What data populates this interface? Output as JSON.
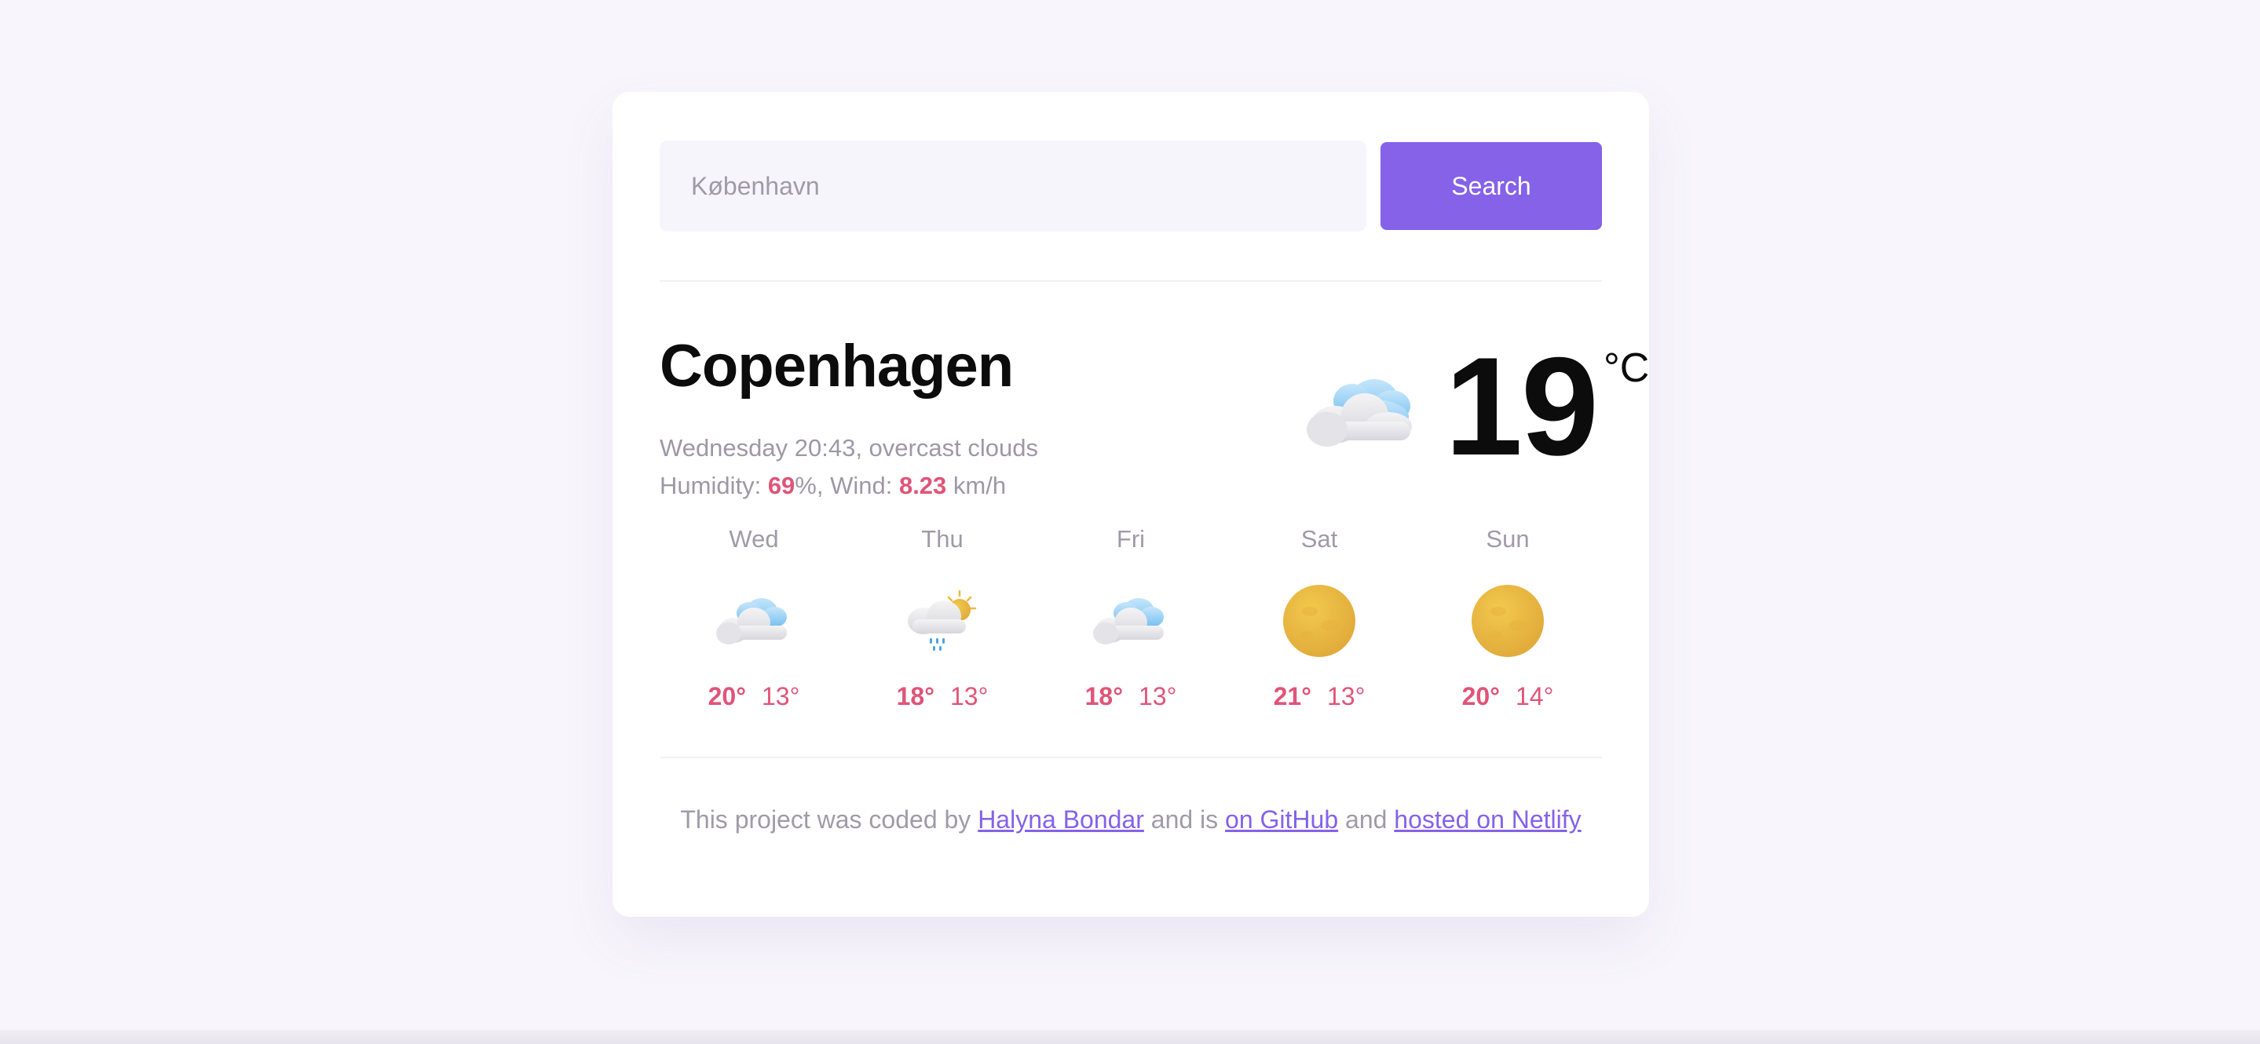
{
  "search": {
    "placeholder": "København",
    "button_label": "Search"
  },
  "current": {
    "city": "Copenhagen",
    "date_line": "Wednesday 20:43, overcast clouds",
    "humidity_label": "Humidity: ",
    "humidity_value": "69",
    "humidity_unit": "%, Wind: ",
    "wind_value": "8.23",
    "wind_unit": " km/h",
    "temperature": "19",
    "unit": "°C",
    "icon": "overcast-clouds-icon"
  },
  "forecast": [
    {
      "day": "Wed",
      "max": "20°",
      "min": "13°",
      "icon": "overcast-clouds-icon"
    },
    {
      "day": "Thu",
      "max": "18°",
      "min": "13°",
      "icon": "rain-sun-cloud-icon"
    },
    {
      "day": "Fri",
      "max": "18°",
      "min": "13°",
      "icon": "overcast-clouds-icon"
    },
    {
      "day": "Sat",
      "max": "21°",
      "min": "13°",
      "icon": "sun-icon"
    },
    {
      "day": "Sun",
      "max": "20°",
      "min": "14°",
      "icon": "sun-icon"
    }
  ],
  "footer": {
    "text_1": "This project was coded by ",
    "author_link": "Halyna Bondar",
    "text_2": " and is ",
    "github_link": "on GitHub",
    "text_3": " and ",
    "netlify_link": "hosted on Netlify"
  },
  "colors": {
    "accent": "#8562e8",
    "highlight": "#e05478",
    "muted_text": "#a09aa8",
    "background": "#f8f6fc"
  }
}
